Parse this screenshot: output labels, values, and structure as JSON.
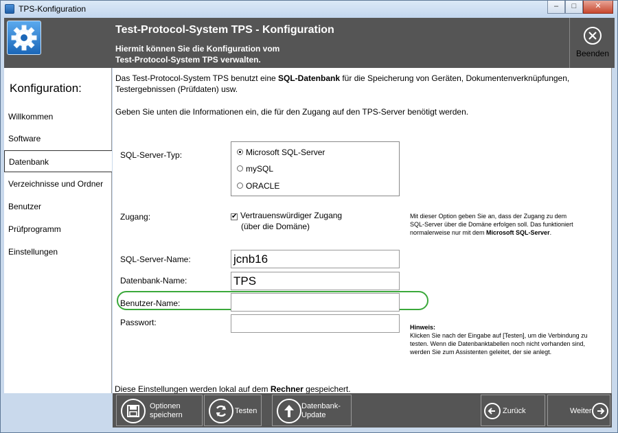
{
  "window": {
    "title": "TPS-Konfiguration",
    "minimize": "–",
    "maximize": "□",
    "close": "✕"
  },
  "header": {
    "title": "Test-Protocol-System TPS - Konfiguration",
    "subtitle_line1": "Hiermit können Sie die Konfiguration vom",
    "subtitle_line2": "Test-Protocol-System TPS verwalten.",
    "quit_label": "Beenden",
    "quit_icon": "×"
  },
  "sidebar": {
    "heading": "Konfiguration:",
    "items": [
      {
        "label": "Willkommen"
      },
      {
        "label": "Software"
      },
      {
        "label": "Datenbank"
      },
      {
        "label": "Verzeichnisse und Ordner"
      },
      {
        "label": "Benutzer"
      },
      {
        "label": "Prüfprogramm"
      },
      {
        "label": "Einstellungen"
      }
    ],
    "active_index": 2
  },
  "main": {
    "intro_pre": "Das Test-Protocol-System TPS benutzt eine ",
    "intro_bold": "SQL-Datenbank",
    "intro_post": " für die Speicherung von Geräten, Dokumentenverknüpfungen,",
    "intro_line2": "Testergebnissen (Prüfdaten) usw.",
    "instruction": "Geben Sie unten die Informationen ein, die für den Zugang auf den TPS-Server benötigt werden.",
    "server_type_label": "SQL-Server-Typ:",
    "server_types": [
      "Microsoft SQL-Server",
      "mySQL",
      "ORACLE"
    ],
    "server_type_selected": "Microsoft SQL-Server",
    "access_label": "Zugang:",
    "trusted_line1": "Vertrauenswürdiger Zugang",
    "trusted_line2": "(über die Domäne)",
    "trusted_checked": true,
    "access_note_line1": "Mit dieser Option geben Sie an, dass der Zugang zu dem",
    "access_note_line2": "SQL-Server über die Domäne erfolgen soll. Das funktioniert",
    "access_note_line3_pre": "normalerweise nur mit dem ",
    "access_note_line3_bold": "Microsoft SQL-Server",
    "access_note_line3_post": ".",
    "server_name_label": "SQL-Server-Name:",
    "server_name_value": "jcnb16",
    "db_name_label": "Datenbank-Name:",
    "db_name_value": "TPS",
    "user_label": "Benutzer-Name:",
    "user_value": "",
    "password_label": "Passwort:",
    "password_value": "",
    "hint_title": "Hinweis:",
    "hint_line1": "Klicken Sie nach der Eingabe auf [Testen], um die Verbindung zu",
    "hint_line2": "testen. Wenn die Datenbanktabellen noch nicht vorhanden sind,",
    "hint_line3": "werden Sie zum Assistenten geleitet, der sie anlegt.",
    "local_pre": "Diese Einstellungen werden lokal auf dem ",
    "local_bold": "Rechner",
    "local_post": " gespeichert."
  },
  "footer": {
    "save_line1": "Optionen",
    "save_line2": "speichern",
    "test": "Testen",
    "update_line1": "Datenbank-",
    "update_line2": "Update",
    "back": "Zurück",
    "next": "Weiter"
  }
}
